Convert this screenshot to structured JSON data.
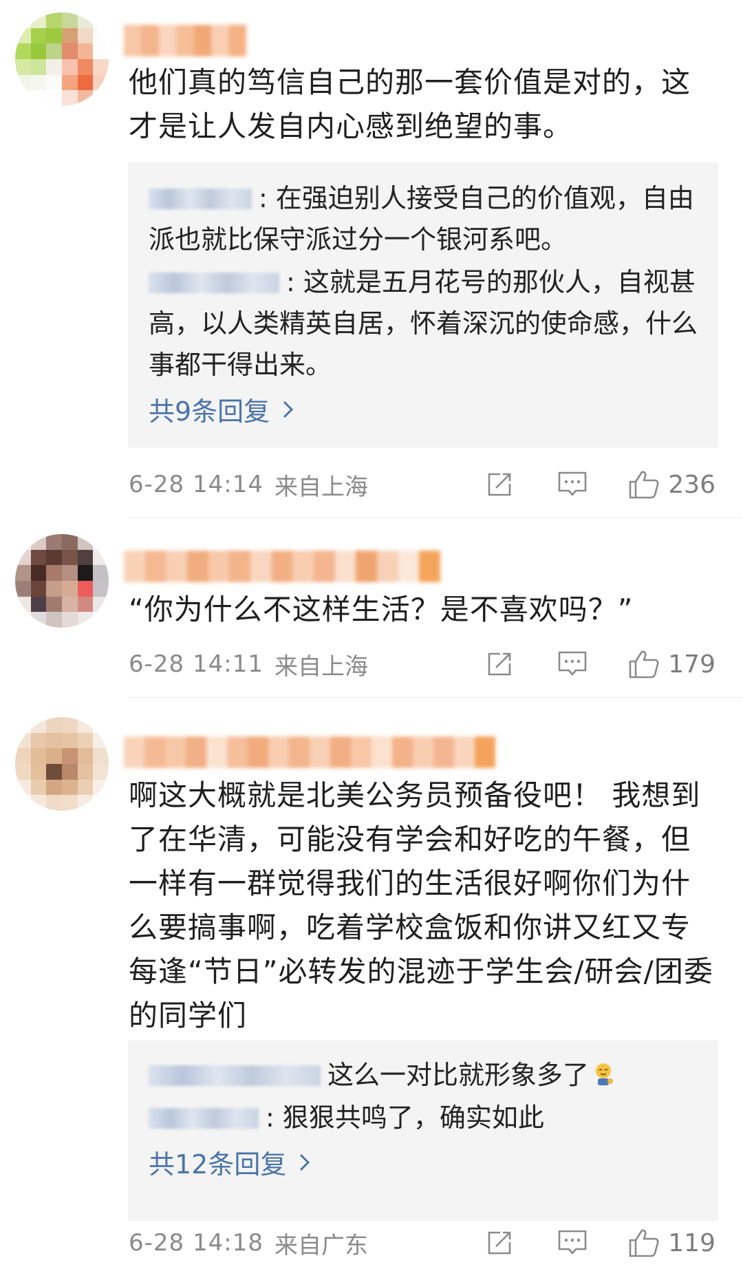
{
  "comments": [
    {
      "text": "他们真的笃信自己的那一套价值是对的，这才是让人发自内心感到绝望的事。",
      "replies": [
        {
          "text": ": 在强迫别人接受自己的价值观，自由派也就比保守派过分一个银河系吧。"
        },
        {
          "text": ": 这就是五月花号的那伙人，自视甚高，以人类精英自居，怀着深沉的使命感，什么事都干得出来。"
        }
      ],
      "more_replies": "共9条回复",
      "time": "6-28 14:14",
      "location": "来自上海",
      "likes": "236"
    },
    {
      "text": "“你为什么不这样生活？是不喜欢吗？”",
      "time": "6-28 14:11",
      "location": "来自上海",
      "likes": "179"
    },
    {
      "text": "啊这大概就是北美公务员预备役吧！ 我想到了在华清，可能没有学会和好吃的午餐，但一样有一群觉得我们的生活很好啊你们为什么要搞事啊，吃着学校盒饭和你讲又红又专每逢“节日”必转发的混迹于学生会/研会/团委的同学们",
      "replies": [
        {
          "text": "这么一对比就形象多了"
        },
        {
          "text": ": 狠狠共鸣了，确实如此"
        }
      ],
      "more_replies": "共12条回复",
      "time": "6-28 14:18",
      "location": "来自广东",
      "likes": "119"
    }
  ],
  "colors": {
    "link": "#4a74a8",
    "meta": "#8a8a8a",
    "reply_bg": "#f4f4f4"
  },
  "icons": [
    "share-icon",
    "comment-icon",
    "like-icon",
    "chevron-right-icon"
  ]
}
